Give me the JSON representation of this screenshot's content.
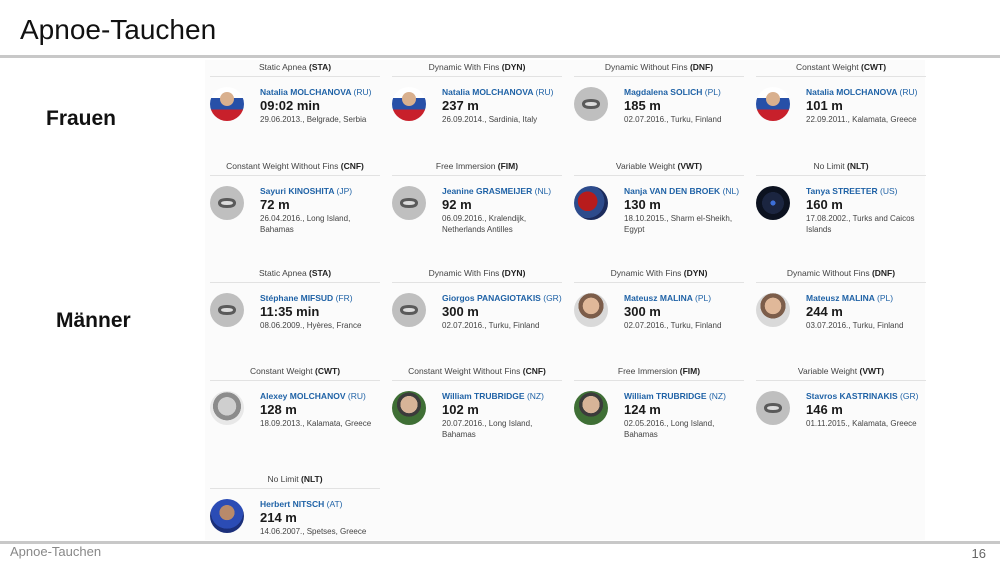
{
  "slide": {
    "title": "Apnoe-Tauchen",
    "footer_left": "Apnoe-Tauchen",
    "page_number": "16"
  },
  "sections": {
    "women": "Frauen",
    "men": "Männer"
  },
  "women": [
    {
      "cat_pre": "Static Apnea ",
      "cat_code": "(STA)",
      "name": "Natalia MOLCHANOVA",
      "country": "(RU)",
      "value": "09:02 min",
      "meta": "29.06.2013., Belgrade, Serbia",
      "avatar": "flag"
    },
    {
      "cat_pre": "Dynamic With Fins ",
      "cat_code": "(DYN)",
      "name": "Natalia MOLCHANOVA",
      "country": "(RU)",
      "value": "237 m",
      "meta": "26.09.2014., Sardinia, Italy",
      "avatar": "flag"
    },
    {
      "cat_pre": "Dynamic Without Fins ",
      "cat_code": "(DNF)",
      "name": "Magdalena SOLICH",
      "country": "(PL)",
      "value": "185 m",
      "meta": "02.07.2016., Turku, Finland",
      "avatar": "mask"
    },
    {
      "cat_pre": "Constant Weight ",
      "cat_code": "(CWT)",
      "name": "Natalia MOLCHANOVA",
      "country": "(RU)",
      "value": "101 m",
      "meta": "22.09.2011., Kalamata, Greece",
      "avatar": "flag"
    },
    {
      "cat_pre": "Constant Weight Without Fins ",
      "cat_code": "(CNF)",
      "name": "Sayuri KINOSHITA",
      "country": "(JP)",
      "value": "72 m",
      "meta": "26.04.2016., Long Island, Bahamas",
      "avatar": "mask"
    },
    {
      "cat_pre": "Free Immersion ",
      "cat_code": "(FIM)",
      "name": "Jeanine GRASMEIJER",
      "country": "(NL)",
      "value": "92 m",
      "meta": "06.09.2016., Kralendijk, Netherlands Antilles",
      "avatar": "mask"
    },
    {
      "cat_pre": "Variable Weight ",
      "cat_code": "(VWT)",
      "name": "Nanja VAN DEN BROEK",
      "country": "(NL)",
      "value": "130 m",
      "meta": "18.10.2015., Sharm el-Sheikh, Egypt",
      "avatar": "red"
    },
    {
      "cat_pre": "No Limit ",
      "cat_code": "(NLT)",
      "name": "Tanya STREETER",
      "country": "(US)",
      "value": "160 m",
      "meta": "17.08.2002., Turks and Caicos Islands",
      "avatar": "dark"
    }
  ],
  "men": [
    {
      "cat_pre": "Static Apnea ",
      "cat_code": "(STA)",
      "name": "Stéphane MIFSUD",
      "country": "(FR)",
      "value": "11:35 min",
      "meta": "08.06.2009., Hyères, France",
      "avatar": "mask"
    },
    {
      "cat_pre": "Dynamic With Fins ",
      "cat_code": "(DYN)",
      "name": "Giorgos PANAGIOTAKIS",
      "country": "(GR)",
      "value": "300 m",
      "meta": "02.07.2016., Turku, Finland",
      "avatar": "mask"
    },
    {
      "cat_pre": "Dynamic With Fins ",
      "cat_code": "(DYN)",
      "name": "Mateusz MALINA",
      "country": "(PL)",
      "value": "300 m",
      "meta": "02.07.2016., Turku, Finland",
      "avatar": "photo"
    },
    {
      "cat_pre": "Dynamic Without Fins ",
      "cat_code": "(DNF)",
      "name": "Mateusz MALINA",
      "country": "(PL)",
      "value": "244 m",
      "meta": "03.07.2016., Turku, Finland",
      "avatar": "photo"
    },
    {
      "cat_pre": "Constant Weight ",
      "cat_code": "(CWT)",
      "name": "Alexey MOLCHANOV",
      "country": "(RU)",
      "value": "128 m",
      "meta": "18.09.2013., Kalamata, Greece",
      "avatar": "face"
    },
    {
      "cat_pre": "Constant Weight Without Fins ",
      "cat_code": "(CNF)",
      "name": "William TRUBRIDGE",
      "country": "(NZ)",
      "value": "102 m",
      "meta": "20.07.2016., Long Island, Bahamas",
      "avatar": "photo2"
    },
    {
      "cat_pre": "Free Immersion ",
      "cat_code": "(FIM)",
      "name": "William TRUBRIDGE",
      "country": "(NZ)",
      "value": "124 m",
      "meta": "02.05.2016., Long Island, Bahamas",
      "avatar": "photo2"
    },
    {
      "cat_pre": "Variable Weight ",
      "cat_code": "(VWT)",
      "name": "Stavros KASTRINAKIS",
      "country": "(GR)",
      "value": "146 m",
      "meta": "01.11.2015., Kalamata, Greece",
      "avatar": "mask"
    },
    {
      "cat_pre": "No Limit ",
      "cat_code": "(NLT)",
      "name": "Herbert NITSCH",
      "country": "(AT)",
      "value": "214 m",
      "meta": "14.06.2007., Spetses, Greece",
      "avatar": "blue"
    }
  ]
}
